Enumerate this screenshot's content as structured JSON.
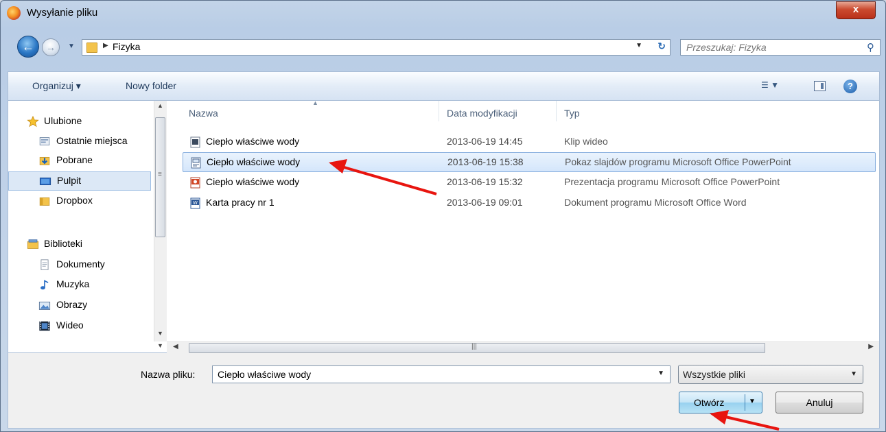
{
  "window": {
    "title": "Wysyłanie pliku",
    "close_label": "x"
  },
  "address": {
    "crumb": "Fizyka",
    "search_placeholder": "Przeszukaj: Fizyka"
  },
  "toolbar": {
    "organize_label": "Organizuj ▾",
    "new_folder_label": "Nowy folder"
  },
  "sidebar": {
    "items": [
      {
        "label": "Ulubione",
        "icon": "star-icon"
      },
      {
        "label": "Ostatnie miejsca",
        "icon": "recent-places-icon"
      },
      {
        "label": "Pobrane",
        "icon": "downloads-icon"
      },
      {
        "label": "Pulpit",
        "icon": "desktop-icon",
        "selected": true
      },
      {
        "label": "Dropbox",
        "icon": "folder-icon"
      },
      {
        "label": "Biblioteki",
        "icon": "libraries-icon"
      },
      {
        "label": "Dokumenty",
        "icon": "documents-icon"
      },
      {
        "label": "Muzyka",
        "icon": "music-icon"
      },
      {
        "label": "Obrazy",
        "icon": "pictures-icon"
      },
      {
        "label": "Wideo",
        "icon": "video-icon"
      }
    ]
  },
  "columns": {
    "name": "Nazwa",
    "date": "Data modyfikacji",
    "type": "Typ"
  },
  "files": [
    {
      "name": "Ciepło właściwe wody",
      "date": "2013-06-19 14:45",
      "type": "Klip wideo",
      "icon": "video-file-icon"
    },
    {
      "name": "Ciepło właściwe wody",
      "date": "2013-06-19 15:38",
      "type": "Pokaz slajdów programu Microsoft Office PowerPoint",
      "icon": "slideshow-file-icon",
      "selected": true
    },
    {
      "name": "Ciepło właściwe wody",
      "date": "2013-06-19 15:32",
      "type": "Prezentacja programu Microsoft Office PowerPoint",
      "icon": "powerpoint-file-icon"
    },
    {
      "name": "Karta pracy nr 1",
      "date": "2013-06-19 09:01",
      "type": "Dokument programu Microsoft Office Word",
      "icon": "word-file-icon"
    }
  ],
  "footer": {
    "filename_label": "Nazwa pliku:",
    "filename_value": "Ciepło właściwe wody",
    "filter_value": "Wszystkie pliki",
    "open_label": "Otwórz",
    "cancel_label": "Anuluj"
  },
  "colors": {
    "annotation_arrow": "#e8150f",
    "selection": "#d4e6fb",
    "accent": "#2a76c4"
  }
}
